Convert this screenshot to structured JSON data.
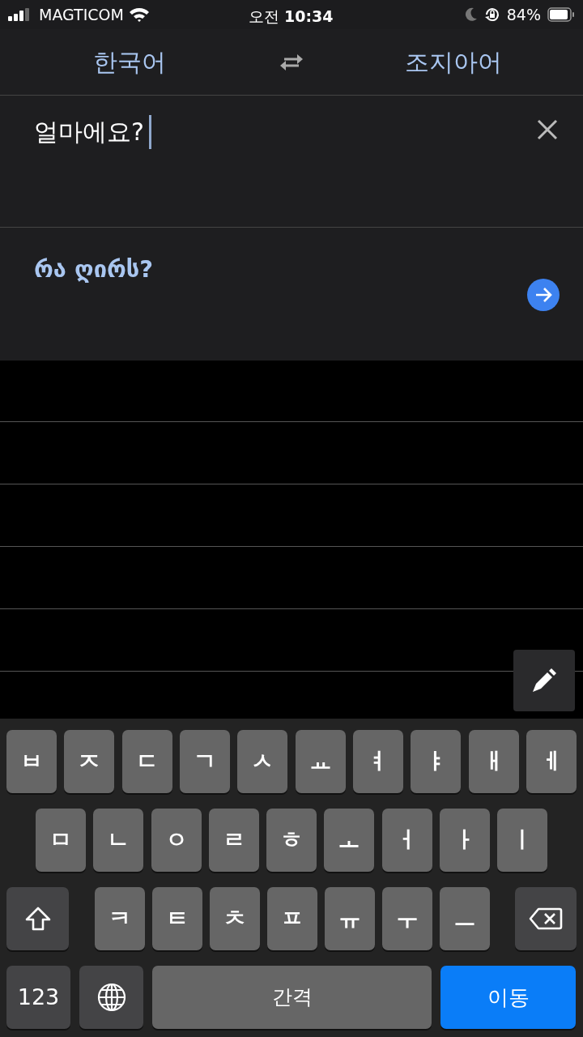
{
  "status_bar": {
    "carrier": "MAGTICOM",
    "time": "오전 **10:34**",
    "battery": "84%"
  },
  "languages": {
    "source": "한국어",
    "target": "조지아어"
  },
  "input": {
    "value": "얼마에요?"
  },
  "translation": {
    "text": "რა ღირს?"
  },
  "keyboard": {
    "rows": [
      {
        "keys": [
          {
            "kind": "letter",
            "label": "ㅂ"
          },
          {
            "kind": "letter",
            "label": "ㅈ"
          },
          {
            "kind": "letter",
            "label": "ㄷ"
          },
          {
            "kind": "letter",
            "label": "ㄱ"
          },
          {
            "kind": "letter",
            "label": "ㅅ"
          },
          {
            "kind": "letter",
            "label": "ㅛ"
          },
          {
            "kind": "letter",
            "label": "ㅕ"
          },
          {
            "kind": "letter",
            "label": "ㅑ"
          },
          {
            "kind": "letter",
            "label": "ㅐ"
          },
          {
            "kind": "letter",
            "label": "ㅔ"
          }
        ]
      },
      {
        "keys": [
          {
            "kind": "letter",
            "label": "ㅁ"
          },
          {
            "kind": "letter",
            "label": "ㄴ"
          },
          {
            "kind": "letter",
            "label": "ㅇ"
          },
          {
            "kind": "letter",
            "label": "ㄹ"
          },
          {
            "kind": "letter",
            "label": "ㅎ"
          },
          {
            "kind": "letter",
            "label": "ㅗ"
          },
          {
            "kind": "letter",
            "label": "ㅓ"
          },
          {
            "kind": "letter",
            "label": "ㅏ"
          },
          {
            "kind": "letter",
            "label": "ㅣ"
          }
        ]
      },
      {
        "keys": [
          {
            "kind": "shift"
          },
          {
            "kind": "letter",
            "label": "ㅋ"
          },
          {
            "kind": "letter",
            "label": "ㅌ"
          },
          {
            "kind": "letter",
            "label": "ㅊ"
          },
          {
            "kind": "letter",
            "label": "ㅍ"
          },
          {
            "kind": "letter",
            "label": "ㅠ"
          },
          {
            "kind": "letter",
            "label": "ㅜ"
          },
          {
            "kind": "letter",
            "label": "ㅡ"
          },
          {
            "kind": "backspace"
          }
        ]
      },
      {
        "keys": [
          {
            "kind": "numbers",
            "label": "123"
          },
          {
            "kind": "globe"
          },
          {
            "kind": "space",
            "label": "간격"
          },
          {
            "kind": "go",
            "label": "이동"
          }
        ]
      }
    ]
  }
}
